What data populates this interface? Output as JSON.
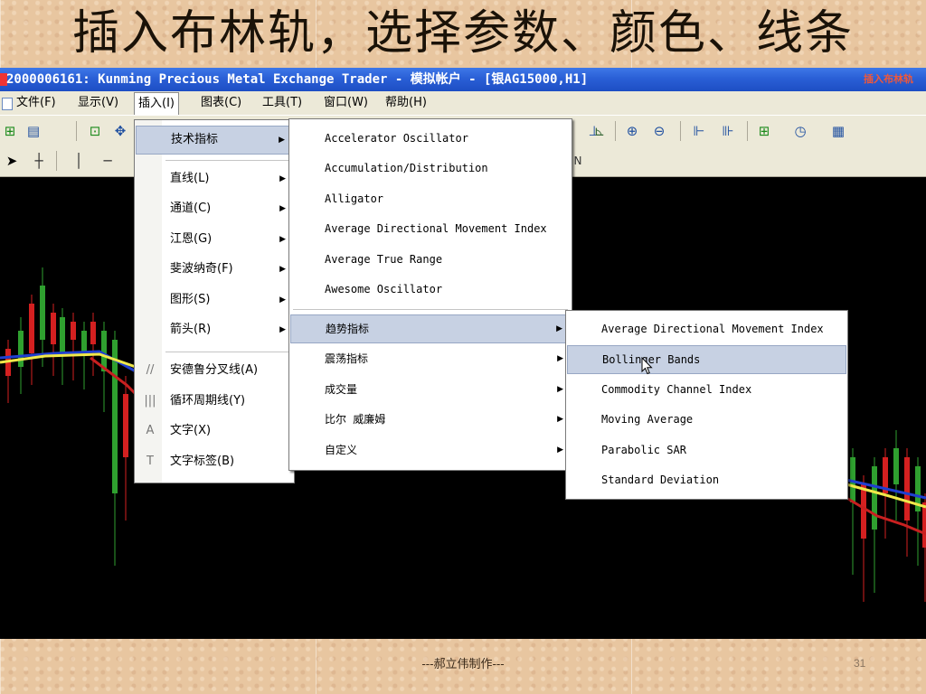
{
  "slide": {
    "title": "插入布林轨，选择参数、颜色、线条",
    "footer": "---郝立伟制作---",
    "page_number": "31"
  },
  "window": {
    "title": "2000006161: Kunming Precious Metal Exchange Trader - 模拟帐户 - [银AG15000,H1]",
    "title_right": "插入布林轨"
  },
  "menubar": {
    "items": [
      "文件(F)",
      "显示(V)",
      "插入(I)",
      "图表(C)",
      "工具(T)",
      "窗口(W)",
      "帮助(H)"
    ],
    "active_index": 2
  },
  "insert_menu": {
    "items": [
      {
        "label": "技术指标",
        "submenu": true,
        "highlighted": true
      },
      {
        "label": "直线(L)",
        "submenu": true
      },
      {
        "label": "通道(C)",
        "submenu": true
      },
      {
        "label": "江恩(G)",
        "submenu": true
      },
      {
        "label": "斐波纳奇(F)",
        "submenu": true
      },
      {
        "label": "图形(S)",
        "submenu": true
      },
      {
        "label": "箭头(R)",
        "submenu": true
      },
      {
        "label": "安德鲁分叉线(A)",
        "icon": "//"
      },
      {
        "label": "循环周期线(Y)",
        "icon": "|||"
      },
      {
        "label": "文字(X)",
        "icon": "A"
      },
      {
        "label": "文字标签(B)",
        "icon": "T"
      }
    ]
  },
  "indicators_menu": {
    "items": [
      {
        "label": "Accelerator Oscillator"
      },
      {
        "label": "Accumulation/Distribution"
      },
      {
        "label": "Alligator"
      },
      {
        "label": "Average Directional Movement Index"
      },
      {
        "label": "Average True Range"
      },
      {
        "label": "Awesome Oscillator"
      },
      {
        "label": "趋势指标",
        "submenu": true,
        "highlighted": true
      },
      {
        "label": "震荡指标",
        "submenu": true
      },
      {
        "label": "成交量",
        "submenu": true
      },
      {
        "label": "比尔 威廉姆",
        "submenu": true
      },
      {
        "label": "自定义",
        "submenu": true
      }
    ]
  },
  "trend_menu": {
    "items": [
      {
        "label": "Average Directional Movement Index"
      },
      {
        "label": "Bollinger Bands",
        "highlighted": true
      },
      {
        "label": "Commodity Channel Index"
      },
      {
        "label": "Moving Average"
      },
      {
        "label": "Parabolic SAR"
      },
      {
        "label": "Standard Deviation"
      }
    ]
  },
  "toolbar_hidden_label": "N",
  "colors": {
    "titlebar": "#2a5fd6",
    "menu_highlight": "#c7d1e3",
    "chart_bg": "#000000",
    "bull_candle": "#2fa02f",
    "bear_candle": "#d42020",
    "ma_yellow": "#f0e84a",
    "ma_blue": "#1f3fd0",
    "ma_red": "#c82020"
  }
}
